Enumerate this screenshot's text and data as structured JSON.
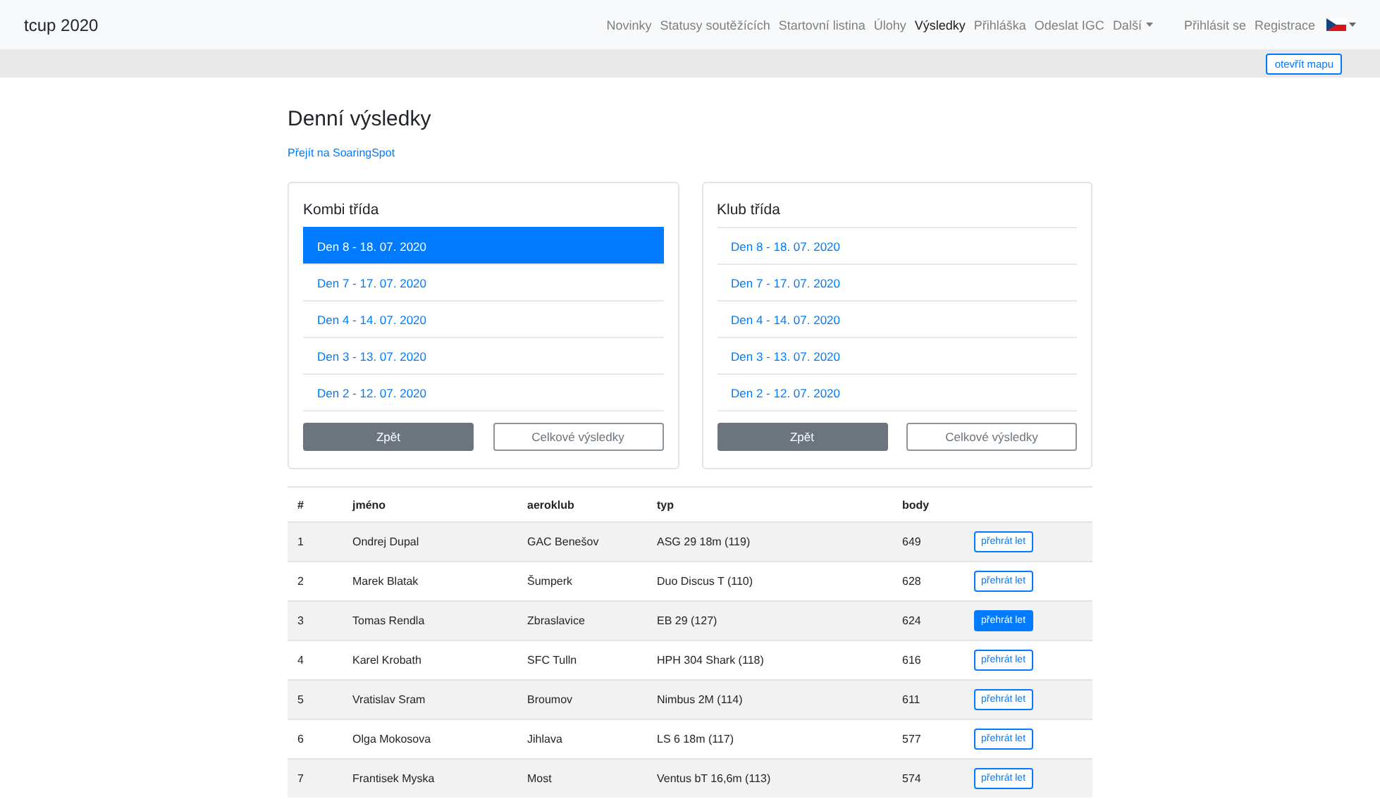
{
  "brand": "tcup 2020",
  "nav": [
    {
      "label": "Novinky",
      "selected": false,
      "dropdown": false
    },
    {
      "label": "Statusy soutěžících",
      "selected": false,
      "dropdown": false
    },
    {
      "label": "Startovní listina",
      "selected": false,
      "dropdown": false
    },
    {
      "label": "Úlohy",
      "selected": false,
      "dropdown": false
    },
    {
      "label": "Výsledky",
      "selected": true,
      "dropdown": false
    },
    {
      "label": "Přihláška",
      "selected": false,
      "dropdown": false
    },
    {
      "label": "Odeslat IGC",
      "selected": false,
      "dropdown": false
    },
    {
      "label": "Další",
      "selected": false,
      "dropdown": true
    }
  ],
  "account": [
    "Přihlásit se",
    "Registrace"
  ],
  "map_button": "otevřít mapu",
  "title": "Denní výsledky",
  "link": "Přejít na SoaringSpot",
  "classes": [
    {
      "title": "Kombi třída",
      "days": [
        {
          "label": "Den 8 - 18. 07. 2020",
          "selected": true
        },
        {
          "label": "Den 7 - 17. 07. 2020",
          "selected": false
        },
        {
          "label": "Den 4 - 14. 07. 2020",
          "selected": false
        },
        {
          "label": "Den 3 - 13. 07. 2020",
          "selected": false
        },
        {
          "label": "Den 2 - 12. 07. 2020",
          "selected": false
        }
      ],
      "back": "Zpět",
      "overall": "Celkové výsledky"
    },
    {
      "title": "Klub třída",
      "days": [
        {
          "label": "Den 8 - 18. 07. 2020",
          "selected": false
        },
        {
          "label": "Den 7 - 17. 07. 2020",
          "selected": false
        },
        {
          "label": "Den 4 - 14. 07. 2020",
          "selected": false
        },
        {
          "label": "Den 3 - 13. 07. 2020",
          "selected": false
        },
        {
          "label": "Den 2 - 12. 07. 2020",
          "selected": false
        }
      ],
      "back": "Zpět",
      "overall": "Celkové výsledky"
    }
  ],
  "table": {
    "columns": [
      "#",
      "jméno",
      "aeroklub",
      "typ",
      "body"
    ],
    "rows": [
      {
        "cells": [
          "1",
          "Ondrej Dupal",
          "GAC Benešov",
          "ASG 29 18m (119)",
          "649"
        ],
        "action": "přehrát let",
        "selected": false
      },
      {
        "cells": [
          "2",
          "Marek Blatak",
          "Šumperk",
          "Duo Discus T (110)",
          "628"
        ],
        "action": "přehrát let",
        "selected": false
      },
      {
        "cells": [
          "3",
          "Tomas Rendla",
          "Zbraslavice",
          "EB 29 (127)",
          "624"
        ],
        "action": "přehrát let",
        "selected": true
      },
      {
        "cells": [
          "4",
          "Karel Krobath",
          "SFC Tulln",
          "HPH 304 Shark (118)",
          "616"
        ],
        "action": "přehrát let",
        "selected": false
      },
      {
        "cells": [
          "5",
          "Vratislav Sram",
          "Broumov",
          "Nimbus 2M (114)",
          "611"
        ],
        "action": "přehrát let",
        "selected": false
      },
      {
        "cells": [
          "6",
          "Olga Mokosova",
          "Jihlava",
          "LS 6 18m (117)",
          "577"
        ],
        "action": "přehrát let",
        "selected": false
      },
      {
        "cells": [
          "7",
          "Frantisek Myska",
          "Most",
          "Ventus bT 16,6m (113)",
          "574"
        ],
        "action": "přehrát let",
        "selected": false
      }
    ]
  }
}
